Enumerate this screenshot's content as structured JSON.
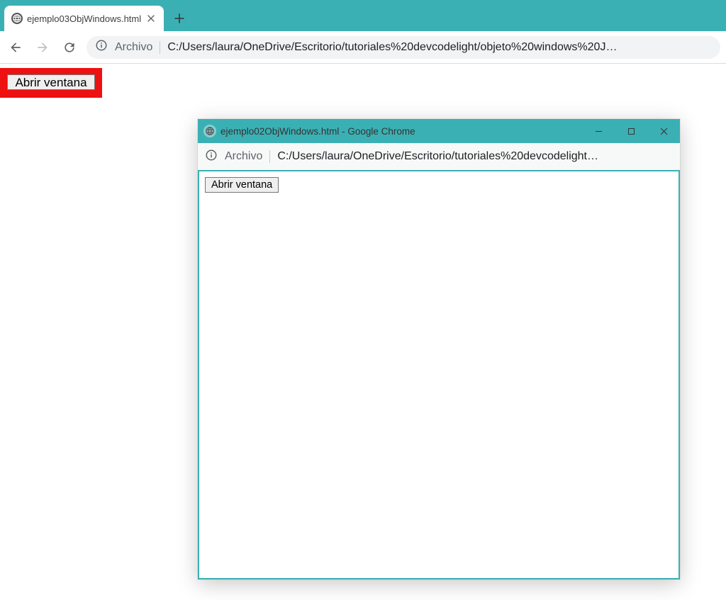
{
  "main_window": {
    "tab": {
      "title": "ejemplo03ObjWindows.html"
    },
    "address": {
      "scheme_label": "Archivo",
      "path": "C:/Users/laura/OneDrive/Escritorio/tutoriales%20devcodelight/objeto%20windows%20J…"
    },
    "page": {
      "button_label": "Abrir ventana"
    }
  },
  "popup_window": {
    "title": "ejemplo02ObjWindows.html - Google Chrome",
    "address": {
      "scheme_label": "Archivo",
      "path": "C:/Users/laura/OneDrive/Escritorio/tutoriales%20devcodelight…"
    },
    "page": {
      "button_label": "Abrir ventana"
    }
  }
}
